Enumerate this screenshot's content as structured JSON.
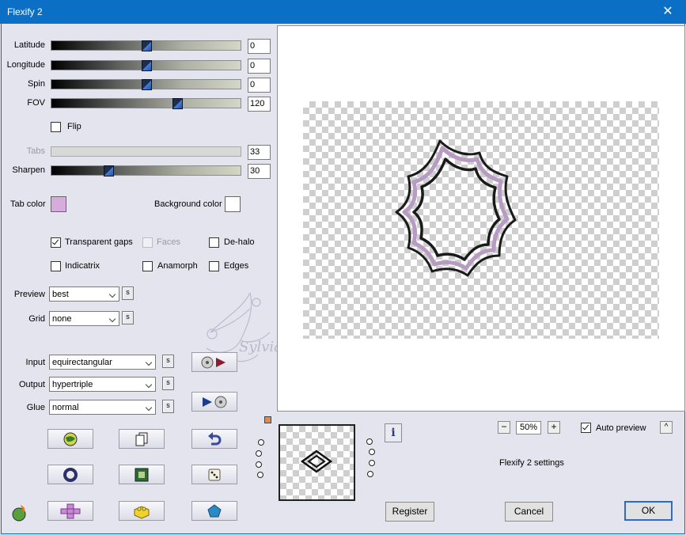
{
  "window": {
    "title": "Flexify 2",
    "close_glyph": "✕"
  },
  "sliders": [
    {
      "label": "Latitude",
      "value": "0",
      "level": 0.5,
      "enabled": true
    },
    {
      "label": "Longitude",
      "value": "0",
      "level": 0.5,
      "enabled": true
    },
    {
      "label": "Spin",
      "value": "0",
      "level": 0.5,
      "enabled": true
    },
    {
      "label": "FOV",
      "value": "120",
      "level": 0.667,
      "enabled": true
    },
    {
      "label": "Tabs",
      "value": "33",
      "level": null,
      "enabled": false
    },
    {
      "label": "Sharpen",
      "value": "30",
      "level": 0.3,
      "enabled": true
    }
  ],
  "flip": {
    "label": "Flip",
    "checked": false
  },
  "tab_color": {
    "label": "Tab color",
    "color": "#d6acdc"
  },
  "background_color": {
    "label": "Background color",
    "color": "#ffffff"
  },
  "options": {
    "transparent_gaps": {
      "label": "Transparent gaps",
      "checked": true
    },
    "faces": {
      "label": "Faces",
      "checked": false,
      "enabled": false
    },
    "de_halo": {
      "label": "De-halo",
      "checked": false
    },
    "indicatrix": {
      "label": "Indicatrix",
      "checked": false
    },
    "anamorph": {
      "label": "Anamorph",
      "checked": false
    },
    "edges": {
      "label": "Edges",
      "checked": false
    }
  },
  "preview_select": {
    "label": "Preview",
    "value": "best",
    "s_button": "s"
  },
  "grid_select": {
    "label": "Grid",
    "value": "none",
    "s_button": "s"
  },
  "input_select": {
    "label": "Input",
    "value": "equirectangular",
    "s_button": "s"
  },
  "output_select": {
    "label": "Output",
    "value": "hypertriple",
    "s_button": "s"
  },
  "glue_select": {
    "label": "Glue",
    "value": "normal",
    "s_button": "s"
  },
  "watermark": {
    "text": "Sylviane"
  },
  "tool_buttons": [
    "globe-icon",
    "copy-icon",
    "undo-icon",
    "ring-icon",
    "frame-icon",
    "dice-icon",
    "cross-icon",
    "brick-icon",
    "pentagon-icon"
  ],
  "zoom": {
    "minus": "−",
    "value": "50%",
    "plus": "+"
  },
  "auto_preview": {
    "label": "Auto preview",
    "checked": true,
    "collapse": "^"
  },
  "settings_label": "Flexify 2 settings",
  "info_glyph": "i",
  "buttons": {
    "register": "Register",
    "cancel": "Cancel",
    "ok": "OK"
  },
  "colors": {
    "accent": "#0b6fc6",
    "thumb": "#2453a8",
    "frame_line": "#1a1a1a",
    "frame_tint": "#b79bc2"
  }
}
